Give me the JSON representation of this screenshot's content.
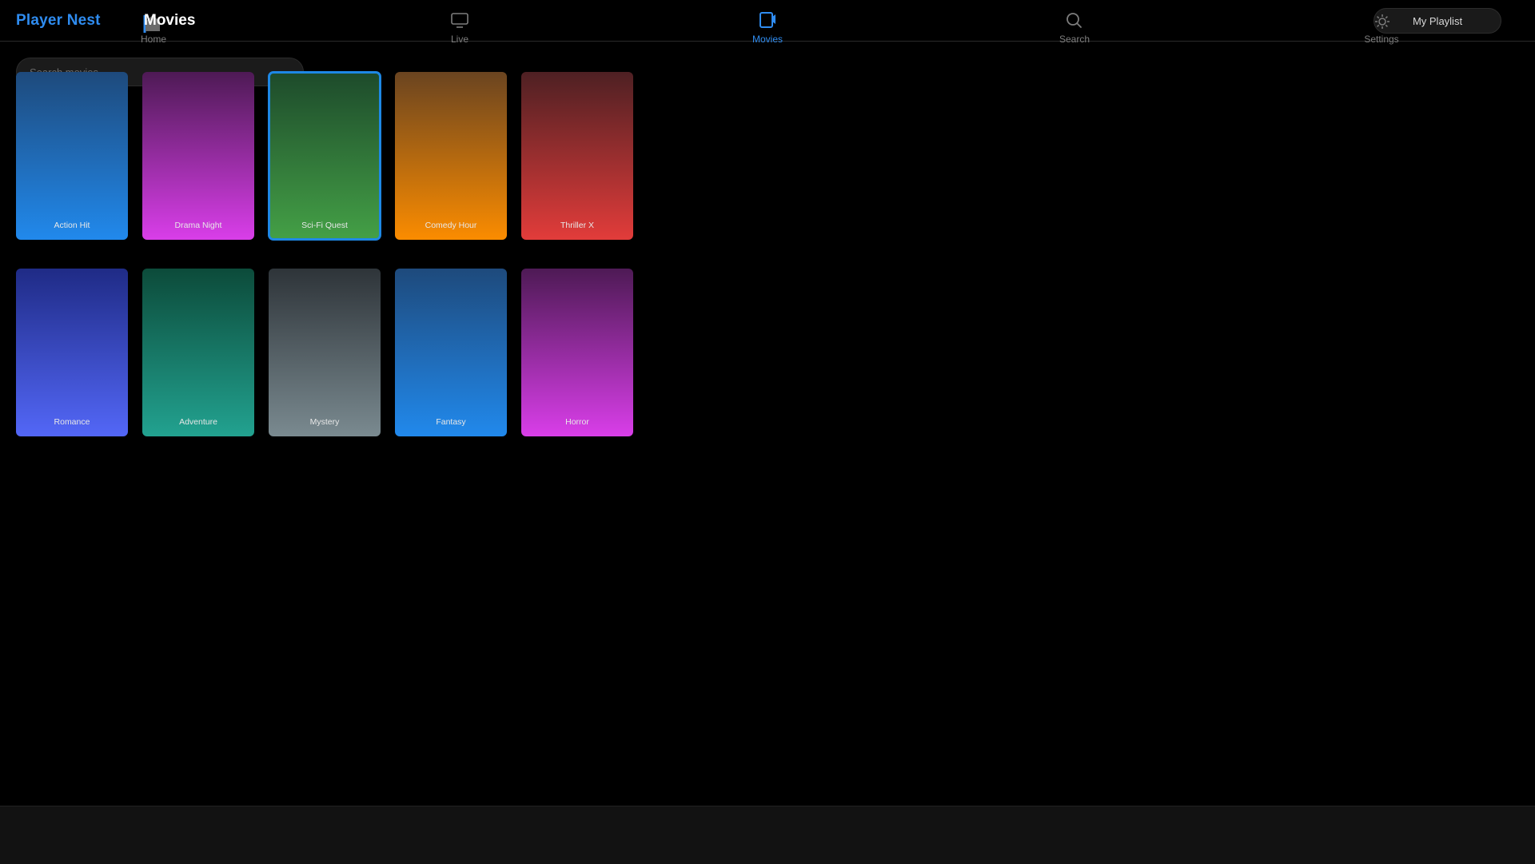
{
  "app": {
    "brand": "Player Nest",
    "page_title": "Movies"
  },
  "nav": [
    {
      "label": "Home",
      "icon": "home-icon",
      "active": false
    },
    {
      "label": "Live",
      "icon": "tv-icon",
      "active": false
    },
    {
      "label": "Movies",
      "icon": "movies-icon",
      "active": true
    },
    {
      "label": "Search",
      "icon": "search-icon",
      "active": false
    },
    {
      "label": "Settings",
      "icon": "gear-icon",
      "active": false
    }
  ],
  "playlist_button": {
    "label": "My Playlist"
  },
  "search": {
    "placeholder": "Search movies..."
  },
  "movies": [
    {
      "title": "Action Hit",
      "top": "#1e4a7c",
      "bottom": "#2189ec"
    },
    {
      "title": "Drama Night",
      "top": "#4e1a55",
      "bottom": "#d93ee9"
    },
    {
      "title": "Sci-Fi Quest",
      "top": "#1d4a2b",
      "bottom": "#44a046",
      "focused": true
    },
    {
      "title": "Comedy Hour",
      "top": "#6a4420",
      "bottom": "#fb8c00"
    },
    {
      "title": "Thriller X",
      "top": "#4e2023",
      "bottom": "#e23c3a"
    },
    {
      "title": "Romance",
      "top": "#1f2b86",
      "bottom": "#5367f7"
    },
    {
      "title": "Adventure",
      "top": "#0c4b3a",
      "bottom": "#22a290"
    },
    {
      "title": "Mystery",
      "top": "#2e3439",
      "bottom": "#7a8a90"
    },
    {
      "title": "Fantasy",
      "top": "#1e4a7c",
      "bottom": "#2189ec"
    },
    {
      "title": "Horror",
      "top": "#4e1a55",
      "bottom": "#d93ee9"
    }
  ],
  "colors": {
    "accent": "#2f8cf0",
    "focus_ring": "#1e88e5"
  }
}
